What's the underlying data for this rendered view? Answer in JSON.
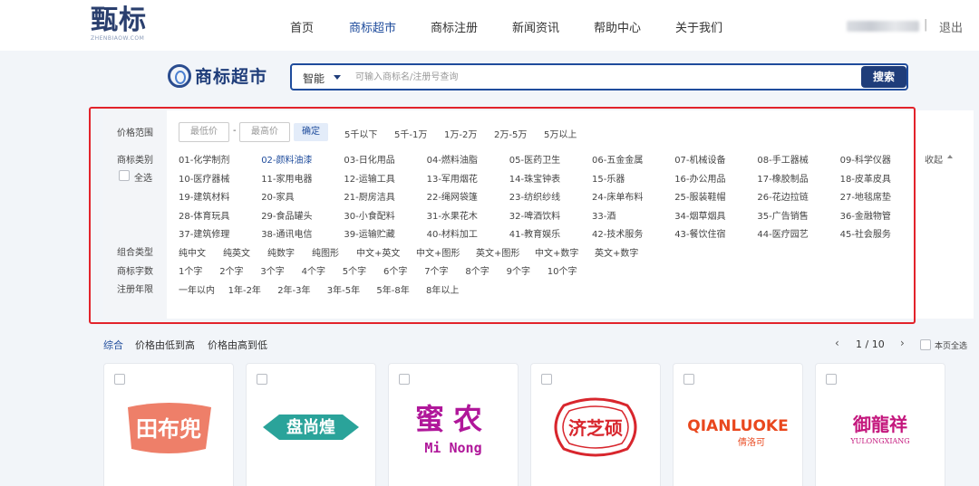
{
  "brand": {
    "name": "甄标",
    "sub": "ZHENBIAOW.COM"
  },
  "nav": [
    "首页",
    "商标超市",
    "商标注册",
    "新闻资讯",
    "帮助中心",
    "关于我们"
  ],
  "user": {
    "separator": "|",
    "logout": "退出"
  },
  "market_title": "商标超市",
  "search": {
    "mode": "智能",
    "placeholder": "可输入商标名/注册号查询",
    "button": "搜索"
  },
  "filters": {
    "labels": {
      "price": "价格范围",
      "category": "商标类别",
      "select_all": "全选",
      "combo": "组合类型",
      "chars": "商标字数",
      "years": "注册年限"
    },
    "price": {
      "min_placeholder": "最低价",
      "dash": "-",
      "max_placeholder": "最高价",
      "confirm": "确定",
      "ranges": [
        "5千以下",
        "5千-1万",
        "1万-2万",
        "2万-5万",
        "5万以上"
      ]
    },
    "categories": [
      "01-化学制剂",
      "02-颜料油漆",
      "03-日化用品",
      "04-燃料油脂",
      "05-医药卫生",
      "06-五金金属",
      "07-机械设备",
      "08-手工器械",
      "09-科学仪器",
      "10-医疗器械",
      "11-家用电器",
      "12-运输工具",
      "13-军用烟花",
      "14-珠宝钟表",
      "15-乐器",
      "16-办公用品",
      "17-橡胶制品",
      "18-皮革皮具",
      "19-建筑材料",
      "20-家具",
      "21-厨房洁具",
      "22-绳网袋篷",
      "23-纺织纱线",
      "24-床单布料",
      "25-服装鞋帽",
      "26-花边拉链",
      "27-地毯席垫",
      "28-体育玩具",
      "29-食品罐头",
      "30-小食配料",
      "31-水果花木",
      "32-啤酒饮料",
      "33-酒",
      "34-烟草烟具",
      "35-广告销售",
      "36-金融物管",
      "37-建筑修理",
      "38-通讯电信",
      "39-运输贮藏",
      "40-材料加工",
      "41-教育娱乐",
      "42-技术服务",
      "43-餐饮住宿",
      "44-医疗园艺",
      "45-社会服务"
    ],
    "selected_category": "02-颜料油漆",
    "collapse": "收起",
    "combos": [
      "纯中文",
      "纯英文",
      "纯数字",
      "纯图形",
      "中文+英文",
      "中文+图形",
      "英文+图形",
      "中文+数字",
      "英文+数字"
    ],
    "char_counts": [
      "1个字",
      "2个字",
      "3个字",
      "4个字",
      "5个字",
      "6个字",
      "7个字",
      "8个字",
      "9个字",
      "10个字"
    ],
    "year_ranges": [
      "一年以内",
      "1年-2年",
      "2年-3年",
      "3年-5年",
      "5年-8年",
      "8年以上"
    ]
  },
  "sort": {
    "options": [
      "综合",
      "价格由低到高",
      "价格由高到低"
    ],
    "active": "综合"
  },
  "pagination": {
    "prev": "‹",
    "current": 1,
    "separator": "/",
    "total": 10,
    "next": "›",
    "select_page": "本页全选"
  },
  "cards": [
    {
      "title": "田布兜",
      "color": "#ee7f69"
    },
    {
      "title": "盘尚煌",
      "color": "#2aa39a"
    },
    {
      "title": "蜜农",
      "subtitle": "Mi Nong",
      "color": "#b0179a"
    },
    {
      "title": "济芝硕",
      "color": "#d8262d"
    },
    {
      "title": "QIANLUOKE",
      "subtitle": "倩洛可",
      "color": "#e9471d"
    },
    {
      "title": "御龍祥",
      "subtitle": "YULONGXIANG",
      "color": "#c4177d"
    }
  ]
}
